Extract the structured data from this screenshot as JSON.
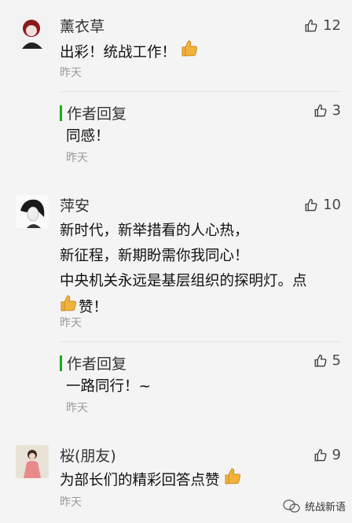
{
  "comments": [
    {
      "name": "薰衣草",
      "likes": "12",
      "text": [
        "出彩！统战工作！"
      ],
      "time": "昨天",
      "reply": {
        "label": "作者回复",
        "likes": "3",
        "text": "同感！",
        "time": "昨天"
      }
    },
    {
      "name": "萍安",
      "likes": "10",
      "text": [
        "新时代，新举措看的人心热，",
        "新征程，新期盼需你我同心！",
        "中央机关永远是基层组织的探明灯。点",
        "赞！"
      ],
      "time": "昨天",
      "reply": {
        "label": "作者回复",
        "likes": "5",
        "text": "一路同行！~",
        "time": "昨天"
      }
    },
    {
      "name": "桜(朋友)",
      "likes": "9",
      "text": [
        "为部长们的精彩回答点赞"
      ],
      "time": "昨天"
    }
  ],
  "watermark": "统战新语",
  "colors": {
    "accent_bar": "#1aad19",
    "emoji_thumb": "#f2b33d"
  }
}
